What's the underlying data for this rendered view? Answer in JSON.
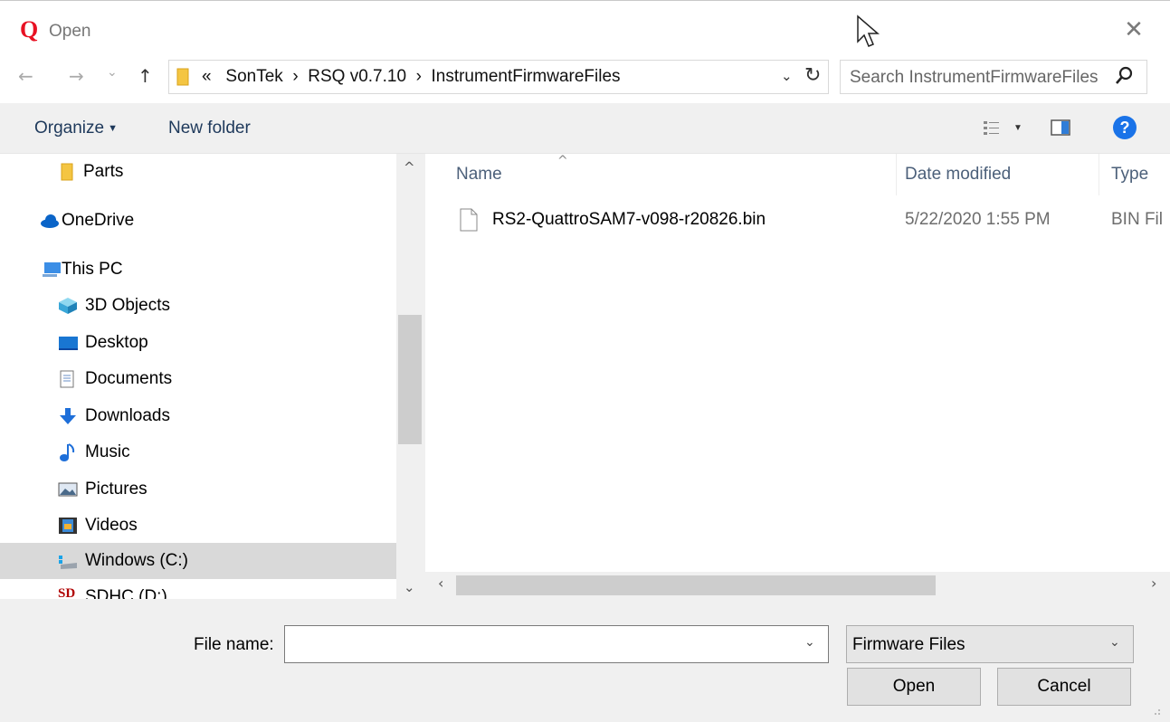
{
  "window": {
    "app_logo": "Q",
    "title": "Open",
    "close_glyph": "✕"
  },
  "nav": {
    "back_glyph": "←",
    "forward_glyph": "→",
    "recent_glyph": "⌄",
    "up_glyph": "↑",
    "address": {
      "overflow": "«",
      "segments": [
        "SonTek",
        "RSQ v0.7.10",
        "InstrumentFirmwareFiles"
      ],
      "separator": "›",
      "dropdown_glyph": "⌄",
      "refresh_glyph": "↻"
    },
    "search": {
      "placeholder": "Search InstrumentFirmwareFiles"
    }
  },
  "toolbar": {
    "organize_label": "Organize",
    "new_folder_label": "New folder",
    "help_label": "?"
  },
  "sidebar": {
    "items": [
      {
        "label": "Parts",
        "icon": "folder-icon"
      },
      {
        "label": "OneDrive",
        "icon": "cloud-icon"
      },
      {
        "label": "This PC",
        "icon": "computer-icon"
      },
      {
        "label": "3D Objects",
        "icon": "cube-icon"
      },
      {
        "label": "Desktop",
        "icon": "desktop-icon"
      },
      {
        "label": "Documents",
        "icon": "documents-icon"
      },
      {
        "label": "Downloads",
        "icon": "download-arrow-icon"
      },
      {
        "label": "Music",
        "icon": "music-note-icon"
      },
      {
        "label": "Pictures",
        "icon": "pictures-icon"
      },
      {
        "label": "Videos",
        "icon": "film-icon"
      },
      {
        "label": "Windows (C:)",
        "icon": "drive-icon"
      },
      {
        "label": "SDHC (D:)",
        "icon": "sd-card-icon"
      }
    ],
    "selected": "Windows (C:)"
  },
  "files": {
    "columns": {
      "name": "Name",
      "date": "Date modified",
      "type": "Type"
    },
    "sort_glyph": "^",
    "rows": [
      {
        "name": "RS2-QuattroSAM7-v098-r20826.bin",
        "date": "5/22/2020 1:55 PM",
        "type": "BIN Fil"
      }
    ]
  },
  "footer": {
    "file_name_label": "File name:",
    "file_name_value": "",
    "filter_value": "Firmware Files",
    "open_label": "Open",
    "cancel_label": "Cancel"
  },
  "colors": {
    "logo": "#e81123",
    "toolbar_bg": "#f0f0f0",
    "selection": "#d9d9d9",
    "help_blue": "#1a73e8",
    "link_text": "#1e395b"
  }
}
